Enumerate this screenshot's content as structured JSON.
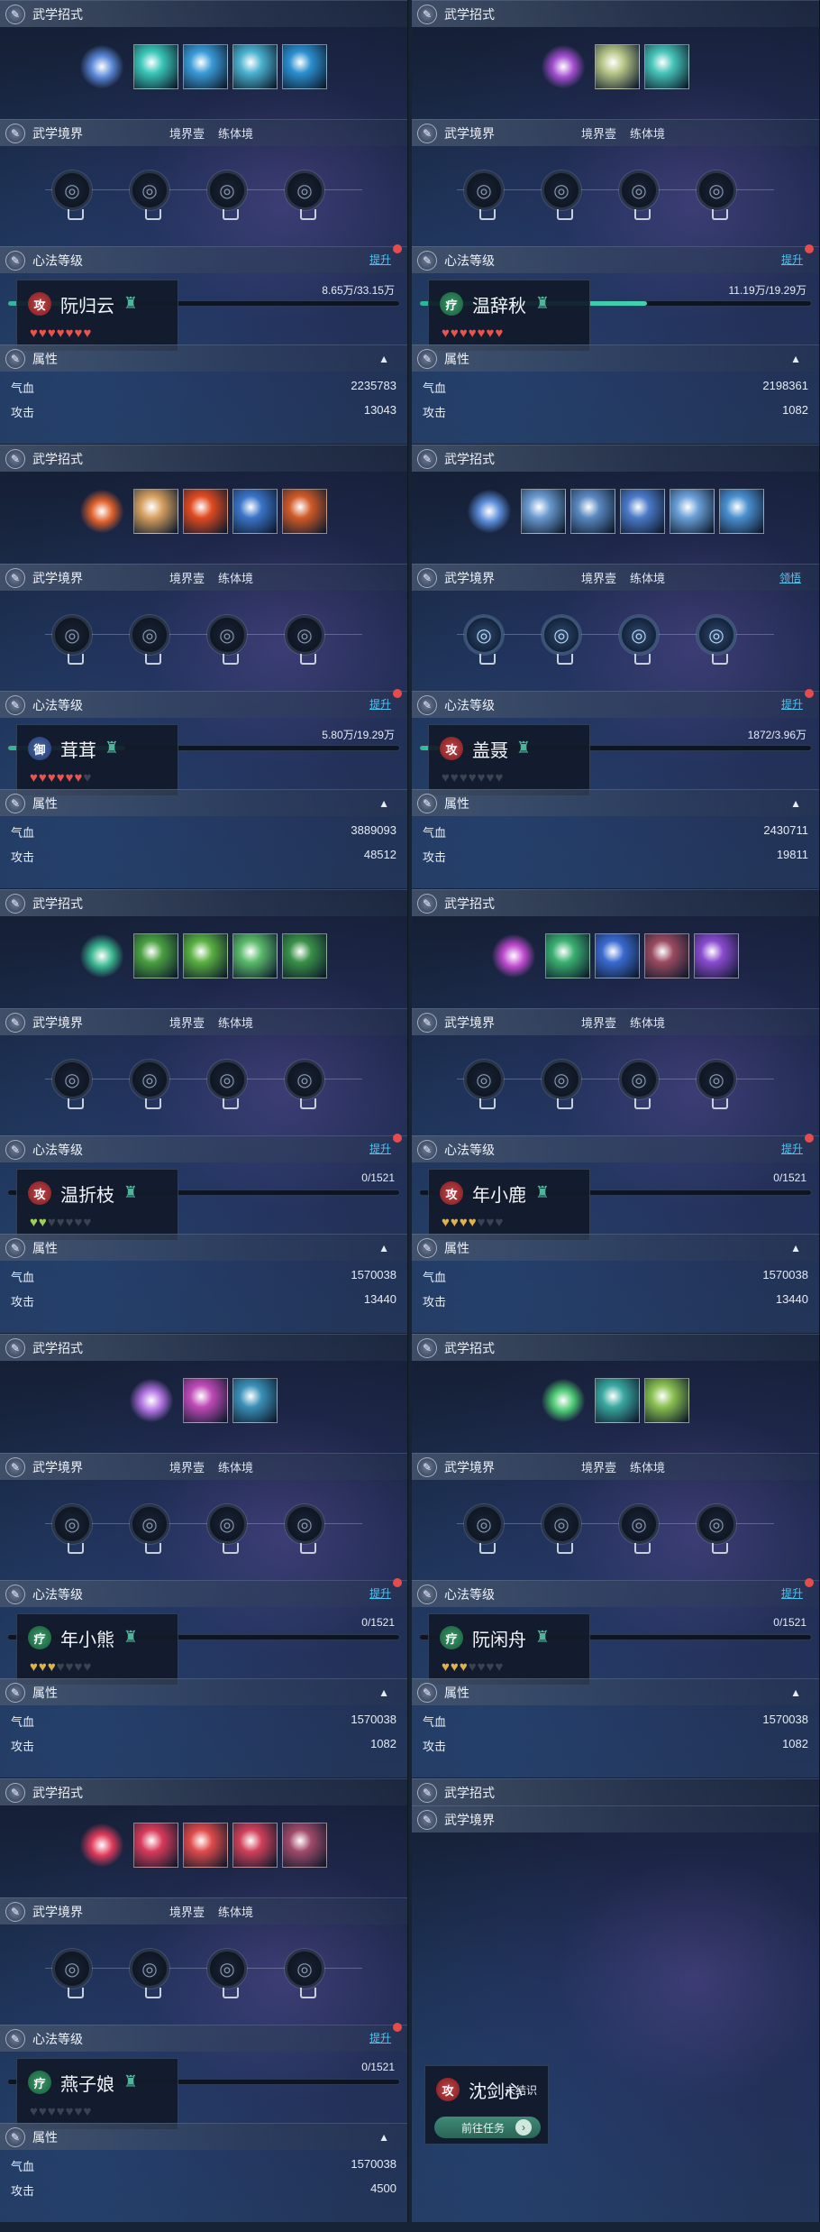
{
  "labels": {
    "skill_header": "武学招式",
    "realm_header": "武学境界",
    "realm_tier1": "境界壹",
    "realm_tier2": "练体境",
    "xinfa_header": "心法等级",
    "upgrade": "提升",
    "comprehend": "领悟",
    "attr_header": "属性",
    "hp": "气血",
    "atk": "攻击",
    "def_partial": "",
    "unknown": "未结识",
    "goto_task": "前往任务"
  },
  "colors": {
    "atk": "#c4464a",
    "heal": "#3a9a6a",
    "def": "#4a6aaa",
    "progress": "#42d2b0",
    "link": "#4ec3f0",
    "alert": "#e74c4c"
  },
  "characters": [
    {
      "name": "阮归云",
      "role": "攻",
      "role_type": "atk",
      "progress_text": "8.65万/33.15万",
      "progress": 0.26,
      "hearts": 7,
      "heart_color": "red",
      "hp": "2235783",
      "attack": "13043",
      "skill_main": "#5a88d8",
      "skills": [
        "#3ac7b8",
        "#3a9bd8",
        "#4ab2d0",
        "#2b8fd0"
      ],
      "realm_lit": false,
      "realm_extra": false
    },
    {
      "name": "温辞秋",
      "role": "疗",
      "role_type": "heal",
      "progress_text": "11.19万/19.29万",
      "progress": 0.58,
      "hearts": 7,
      "heart_color": "red",
      "hp": "2198361",
      "attack": "1082",
      "skill_main": "#a34ed0",
      "skills": [
        "#b8c688",
        "#46c4b8"
      ],
      "realm_lit": false,
      "realm_extra": false
    },
    {
      "name": "茸茸",
      "role": "御",
      "role_type": "def",
      "progress_text": "5.80万/19.29万",
      "progress": 0.3,
      "hearts": 6,
      "heart_color": "red",
      "hp": "3889093",
      "attack": "48512",
      "skill_main": "#e0602a",
      "skills": [
        "#d6a060",
        "#e04a20",
        "#3a74c8",
        "#d05a28"
      ],
      "realm_lit": false,
      "realm_extra": false
    },
    {
      "name": "盖聂",
      "role": "攻",
      "role_type": "atk",
      "progress_text": "1872/3.96万",
      "progress": 0.05,
      "hearts": 0,
      "heart_color": "red",
      "hp": "2430711",
      "attack": "19811",
      "skill_main": "#5a8ad8",
      "skills": [
        "#6a9ad0",
        "#5a88c0",
        "#4a7ac8",
        "#6aa0d8",
        "#4a90d0"
      ],
      "realm_lit": true,
      "realm_extra": true
    },
    {
      "name": "温折枝",
      "role": "攻",
      "role_type": "atk",
      "progress_text": "0/1521",
      "progress": 0,
      "hearts": 2,
      "heart_color": "green",
      "hp": "1570038",
      "attack": "13440",
      "skill_main": "#3ab890",
      "skills": [
        "#4aa040",
        "#5ab040",
        "#5aba6a",
        "#3a9048"
      ],
      "realm_lit": false,
      "realm_extra": false
    },
    {
      "name": "年小鹿",
      "role": "攻",
      "role_type": "atk",
      "progress_text": "0/1521",
      "progress": 0,
      "hearts": 4,
      "heart_color": "gold",
      "hp": "1570038",
      "attack": "13440",
      "skill_main": "#c04ad0",
      "skills": [
        "#3ab070",
        "#3a6ad0",
        "#9a4a60",
        "#8a4ad0"
      ],
      "realm_lit": false,
      "realm_extra": false
    },
    {
      "name": "年小熊",
      "role": "疗",
      "role_type": "heal",
      "progress_text": "0/1521",
      "progress": 0,
      "hearts": 3,
      "heart_color": "gold",
      "hp": "1570038",
      "attack": "1082",
      "skill_main": "#b070e0",
      "skills": [
        "#c04ab8",
        "#3a90b8"
      ],
      "realm_lit": false,
      "realm_extra": false
    },
    {
      "name": "阮闲舟",
      "role": "疗",
      "role_type": "heal",
      "progress_text": "0/1521",
      "progress": 0,
      "hearts": 3,
      "heart_color": "gold",
      "hp": "1570038",
      "attack": "1082",
      "skill_main": "#4ac870",
      "skills": [
        "#3aa8a0",
        "#8ac050"
      ],
      "realm_lit": false,
      "realm_extra": false
    },
    {
      "name": "燕子娘",
      "role": "疗",
      "role_type": "heal",
      "progress_text": "0/1521",
      "progress": 0,
      "hearts": 0,
      "heart_color": "gold",
      "hp": "1570038",
      "attack": "4500",
      "skill_main": "#e03a5a",
      "skills": [
        "#d83a5a",
        "#e04a4a",
        "#d0405a",
        "#a04a6a"
      ],
      "realm_lit": false,
      "realm_extra": false
    }
  ],
  "locked_character": {
    "name": "沈剑心",
    "role": "攻",
    "role_type": "atk"
  }
}
